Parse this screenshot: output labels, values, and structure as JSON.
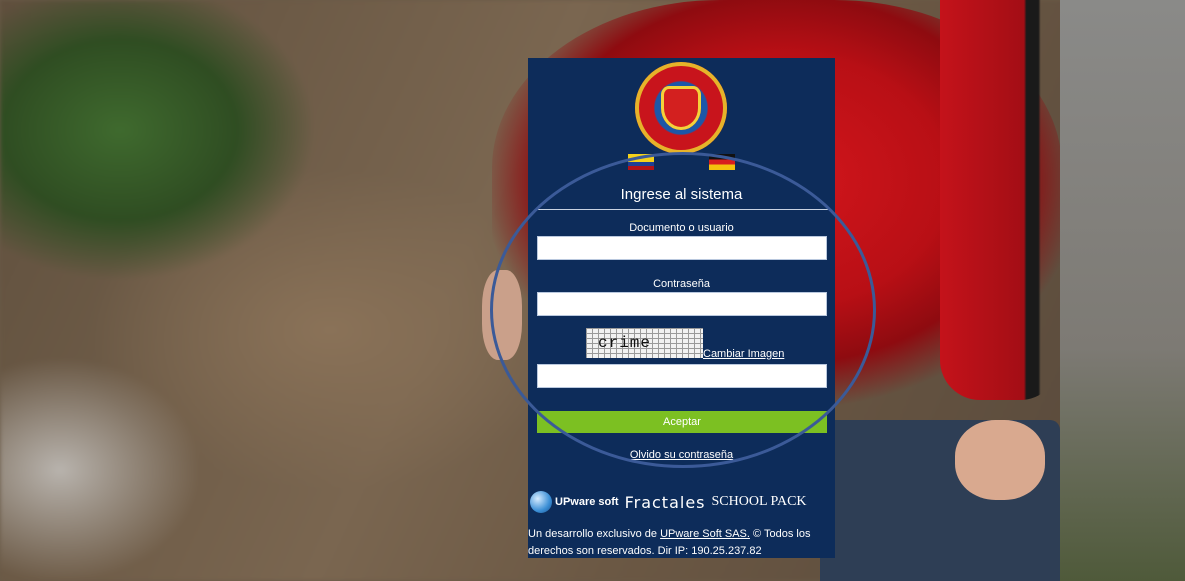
{
  "login": {
    "heading": "Ingrese al sistema",
    "user_label": "Documento o usuario",
    "user_value": "",
    "password_label": "Contraseña",
    "password_value": "",
    "captcha_text": "crime",
    "captcha_link": "Cambiar Imagen",
    "captcha_value": "",
    "accept_label": "Aceptar",
    "forgot_label": "Olvido su contraseña"
  },
  "languages": [
    {
      "name": "spanish-flag-icon"
    },
    {
      "name": "german-flag-icon"
    }
  ],
  "branding": {
    "upware": "UPware soft",
    "fractales": "Fractales",
    "schoolpack": "SCHOOL PACK"
  },
  "footer": {
    "prefix": "Un desarrollo exclusivo de",
    "company_link": "UPware Soft SAS.",
    "suffix": "© Todos los derechos son reservados. Dir IP:",
    "ip": "190.25.237.82"
  },
  "colors": {
    "panel": "#0d2c5a",
    "accept": "#7cc022",
    "annotation_ellipse": "#3b5a98"
  }
}
